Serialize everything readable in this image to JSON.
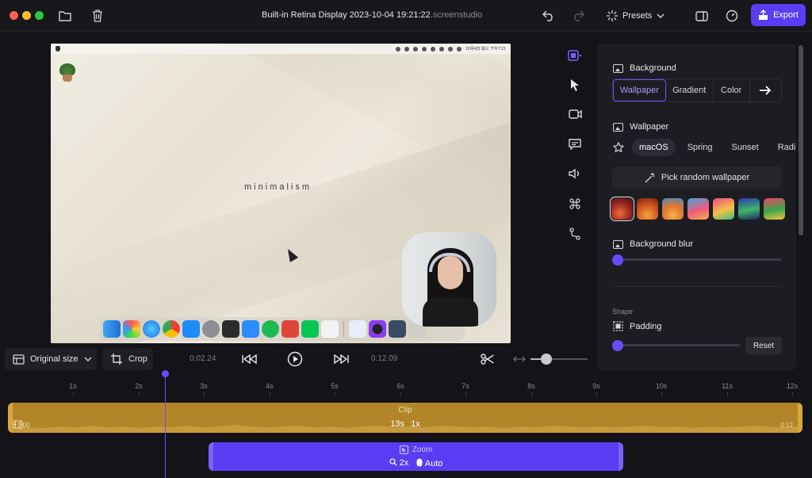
{
  "window": {
    "title": "Built-in Retina Display 2023-10-04 19:21:22",
    "title_ext": ".screenstudio"
  },
  "toolbar": {
    "presets_label": "Presets",
    "export_label": "Export",
    "accent_color": "#5b3df5"
  },
  "canvas": {
    "wallpaper_text": "minimalism",
    "menubar_clock": "10月4日 週三 下午7:21"
  },
  "panel": {
    "background_title": "Background",
    "tabs": [
      {
        "label": "Wallpaper",
        "active": true
      },
      {
        "label": "Gradient",
        "active": false
      },
      {
        "label": "Color",
        "active": false
      }
    ],
    "wallpaper_title": "Wallpaper",
    "categories": [
      {
        "label": "macOS",
        "active": true
      },
      {
        "label": "Spring",
        "active": false
      },
      {
        "label": "Sunset",
        "active": false
      },
      {
        "label": "Radia",
        "active": false
      }
    ],
    "random_label": "Pick random wallpaper",
    "wallpapers": [
      {
        "name": "wallpaper-1",
        "selected": true
      },
      {
        "name": "wallpaper-2",
        "selected": false
      },
      {
        "name": "wallpaper-3",
        "selected": false
      },
      {
        "name": "wallpaper-4",
        "selected": false
      },
      {
        "name": "wallpaper-5",
        "selected": false
      },
      {
        "name": "wallpaper-6",
        "selected": false
      },
      {
        "name": "wallpaper-7",
        "selected": false
      }
    ],
    "blur_title": "Background blur",
    "blur_value": 0,
    "shape_label": "Shape",
    "padding_title": "Padding",
    "padding_value": 0,
    "reset_label": "Reset"
  },
  "controls": {
    "size_label": "Original size",
    "crop_label": "Crop",
    "current_time": "0:02.24",
    "total_time": "0:12.09"
  },
  "timeline": {
    "ticks": [
      "1s",
      "2s",
      "3s",
      "4s",
      "5s",
      "6s",
      "7s",
      "8s",
      "9s",
      "10s",
      "11s",
      "12s"
    ],
    "clip": {
      "label": "Clip",
      "duration": "13s",
      "speed": "1x",
      "start": "0:00",
      "end": "0:12"
    },
    "zoom": {
      "label": "Zoom",
      "level": "2x",
      "mode": "Auto"
    }
  }
}
